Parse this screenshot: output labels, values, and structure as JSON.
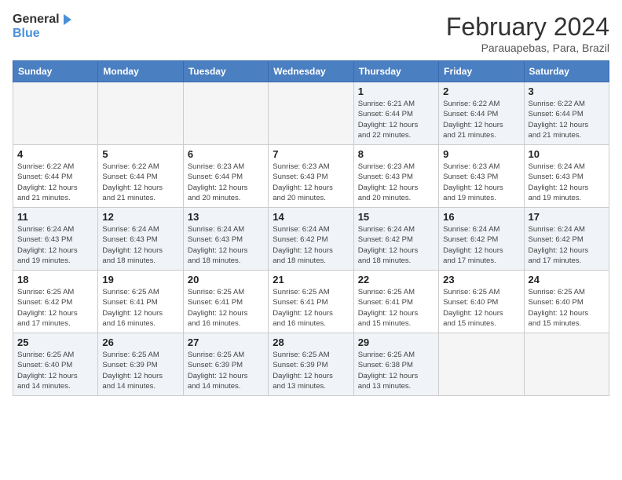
{
  "logo": {
    "line1": "General",
    "line2": "Blue"
  },
  "title": "February 2024",
  "subtitle": "Parauapebas, Para, Brazil",
  "weekdays": [
    "Sunday",
    "Monday",
    "Tuesday",
    "Wednesday",
    "Thursday",
    "Friday",
    "Saturday"
  ],
  "weeks": [
    [
      {
        "day": "",
        "info": ""
      },
      {
        "day": "",
        "info": ""
      },
      {
        "day": "",
        "info": ""
      },
      {
        "day": "",
        "info": ""
      },
      {
        "day": "1",
        "info": "Sunrise: 6:21 AM\nSunset: 6:44 PM\nDaylight: 12 hours\nand 22 minutes."
      },
      {
        "day": "2",
        "info": "Sunrise: 6:22 AM\nSunset: 6:44 PM\nDaylight: 12 hours\nand 21 minutes."
      },
      {
        "day": "3",
        "info": "Sunrise: 6:22 AM\nSunset: 6:44 PM\nDaylight: 12 hours\nand 21 minutes."
      }
    ],
    [
      {
        "day": "4",
        "info": "Sunrise: 6:22 AM\nSunset: 6:44 PM\nDaylight: 12 hours\nand 21 minutes."
      },
      {
        "day": "5",
        "info": "Sunrise: 6:22 AM\nSunset: 6:44 PM\nDaylight: 12 hours\nand 21 minutes."
      },
      {
        "day": "6",
        "info": "Sunrise: 6:23 AM\nSunset: 6:44 PM\nDaylight: 12 hours\nand 20 minutes."
      },
      {
        "day": "7",
        "info": "Sunrise: 6:23 AM\nSunset: 6:43 PM\nDaylight: 12 hours\nand 20 minutes."
      },
      {
        "day": "8",
        "info": "Sunrise: 6:23 AM\nSunset: 6:43 PM\nDaylight: 12 hours\nand 20 minutes."
      },
      {
        "day": "9",
        "info": "Sunrise: 6:23 AM\nSunset: 6:43 PM\nDaylight: 12 hours\nand 19 minutes."
      },
      {
        "day": "10",
        "info": "Sunrise: 6:24 AM\nSunset: 6:43 PM\nDaylight: 12 hours\nand 19 minutes."
      }
    ],
    [
      {
        "day": "11",
        "info": "Sunrise: 6:24 AM\nSunset: 6:43 PM\nDaylight: 12 hours\nand 19 minutes."
      },
      {
        "day": "12",
        "info": "Sunrise: 6:24 AM\nSunset: 6:43 PM\nDaylight: 12 hours\nand 18 minutes."
      },
      {
        "day": "13",
        "info": "Sunrise: 6:24 AM\nSunset: 6:43 PM\nDaylight: 12 hours\nand 18 minutes."
      },
      {
        "day": "14",
        "info": "Sunrise: 6:24 AM\nSunset: 6:42 PM\nDaylight: 12 hours\nand 18 minutes."
      },
      {
        "day": "15",
        "info": "Sunrise: 6:24 AM\nSunset: 6:42 PM\nDaylight: 12 hours\nand 18 minutes."
      },
      {
        "day": "16",
        "info": "Sunrise: 6:24 AM\nSunset: 6:42 PM\nDaylight: 12 hours\nand 17 minutes."
      },
      {
        "day": "17",
        "info": "Sunrise: 6:24 AM\nSunset: 6:42 PM\nDaylight: 12 hours\nand 17 minutes."
      }
    ],
    [
      {
        "day": "18",
        "info": "Sunrise: 6:25 AM\nSunset: 6:42 PM\nDaylight: 12 hours\nand 17 minutes."
      },
      {
        "day": "19",
        "info": "Sunrise: 6:25 AM\nSunset: 6:41 PM\nDaylight: 12 hours\nand 16 minutes."
      },
      {
        "day": "20",
        "info": "Sunrise: 6:25 AM\nSunset: 6:41 PM\nDaylight: 12 hours\nand 16 minutes."
      },
      {
        "day": "21",
        "info": "Sunrise: 6:25 AM\nSunset: 6:41 PM\nDaylight: 12 hours\nand 16 minutes."
      },
      {
        "day": "22",
        "info": "Sunrise: 6:25 AM\nSunset: 6:41 PM\nDaylight: 12 hours\nand 15 minutes."
      },
      {
        "day": "23",
        "info": "Sunrise: 6:25 AM\nSunset: 6:40 PM\nDaylight: 12 hours\nand 15 minutes."
      },
      {
        "day": "24",
        "info": "Sunrise: 6:25 AM\nSunset: 6:40 PM\nDaylight: 12 hours\nand 15 minutes."
      }
    ],
    [
      {
        "day": "25",
        "info": "Sunrise: 6:25 AM\nSunset: 6:40 PM\nDaylight: 12 hours\nand 14 minutes."
      },
      {
        "day": "26",
        "info": "Sunrise: 6:25 AM\nSunset: 6:39 PM\nDaylight: 12 hours\nand 14 minutes."
      },
      {
        "day": "27",
        "info": "Sunrise: 6:25 AM\nSunset: 6:39 PM\nDaylight: 12 hours\nand 14 minutes."
      },
      {
        "day": "28",
        "info": "Sunrise: 6:25 AM\nSunset: 6:39 PM\nDaylight: 12 hours\nand 13 minutes."
      },
      {
        "day": "29",
        "info": "Sunrise: 6:25 AM\nSunset: 6:38 PM\nDaylight: 12 hours\nand 13 minutes."
      },
      {
        "day": "",
        "info": ""
      },
      {
        "day": "",
        "info": ""
      }
    ]
  ]
}
